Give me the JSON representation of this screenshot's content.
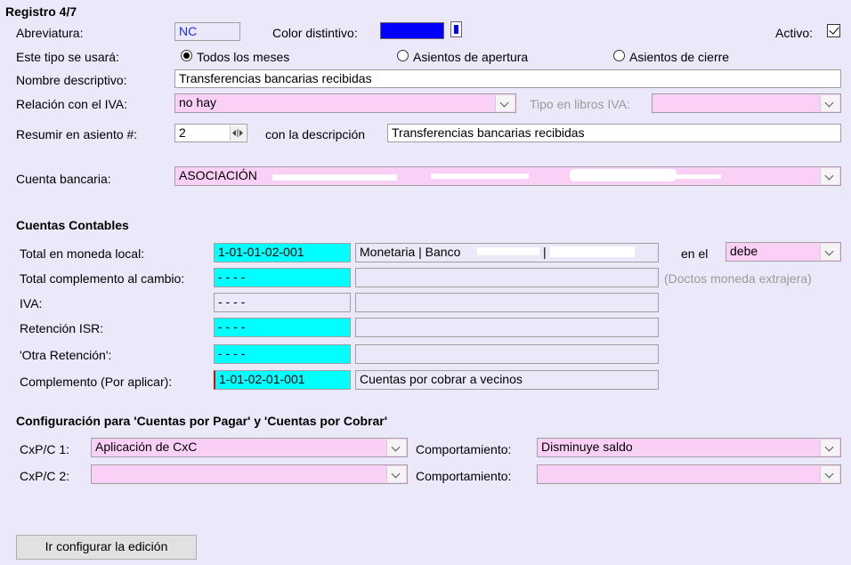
{
  "header": {
    "title": "Registro 4/7"
  },
  "general": {
    "abreviatura_label": "Abreviatura:",
    "abreviatura_value": "NC",
    "color_label": "Color distintivo:",
    "color_value": "#0000ff",
    "activo_label": "Activo:",
    "tipo_label": "Este tipo se usará:",
    "radio_options": [
      "Todos los meses",
      "Asientos de apertura",
      "Asientos de cierre"
    ],
    "radio_selected": "Todos los meses",
    "nombre_label": "Nombre descriptivo:",
    "nombre_value": "Transferencias bancarias recibidas",
    "iva_label": "Relación con el IVA:",
    "iva_value": "no hay",
    "tipo_iva_label": "Tipo en libros IVA:",
    "tipo_iva_value": "",
    "resumir_label": "Resumir en asiento #:",
    "resumir_value": "2",
    "descripcion_label": "con la descripción",
    "descripcion_value": "Transferencias bancarias recibidas",
    "cuenta_label": "Cuenta bancaria:",
    "cuenta_value": "ASOCIACIÓN"
  },
  "cuentas": {
    "title": "Cuentas Contables",
    "rows": [
      {
        "label": "Total en moneda local:",
        "code": "1-01-01-02-001",
        "desc": "Monetaria | Banco",
        "sep": "|"
      },
      {
        "label": "Total complemento al cambio:",
        "code": "- - - -",
        "desc": ""
      },
      {
        "label": "IVA:",
        "code": "- - - -",
        "desc": ""
      },
      {
        "label": "Retención ISR:",
        "code": "- - - -",
        "desc": ""
      },
      {
        "label": "'Otra Retención':",
        "code": "- - - -",
        "desc": ""
      },
      {
        "label": "Complemento (Por aplicar):",
        "code": "1-01-02-01-001",
        "desc": "Cuentas por cobrar a vecinos"
      }
    ],
    "en_el_label": "en el",
    "en_el_value": "debe",
    "note": "(Doctos moneda extrajera)"
  },
  "cxp": {
    "title": "Configuración para 'Cuentas por Pagar' y 'Cuentas por Cobrar'",
    "c1_label": "CxP/C 1:",
    "c1_value": "Aplicación de CxC",
    "c2_label": "CxP/C 2:",
    "c2_value": "",
    "comp_label": "Comportamiento:",
    "comp1_value": "Disminuye saldo",
    "comp2_value": ""
  },
  "footer": {
    "button_label": "Ir configurar la edición"
  }
}
